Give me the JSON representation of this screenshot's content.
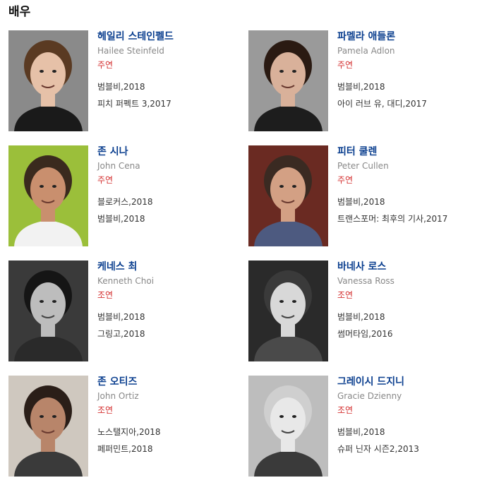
{
  "section": {
    "title": "배우"
  },
  "actors": [
    {
      "name": "헤일리 스테인펠드",
      "en_name": "Hailee Steinfeld",
      "role": "주연",
      "works": [
        "범블비,2018",
        "피치 퍼펙트 3,2017"
      ],
      "photo": {
        "bg": "#8a8a8a",
        "skin": "#e6c1a8",
        "hair": "#5a3a22",
        "shirt": "#1a1a1a",
        "gray": false
      }
    },
    {
      "name": "파멜라 애들론",
      "en_name": "Pamela Adlon",
      "role": "주연",
      "works": [
        "범블비,2018",
        "아이 러브 유, 대디,2017"
      ],
      "photo": {
        "bg": "#9a9a9a",
        "skin": "#d9b19a",
        "hair": "#2a1a12",
        "shirt": "#1d1d1d",
        "gray": false
      }
    },
    {
      "name": "존 시나",
      "en_name": "John Cena",
      "role": "주연",
      "works": [
        "블로커스,2018",
        "범블비,2018"
      ],
      "photo": {
        "bg": "#9bbf3a",
        "skin": "#c98f6e",
        "hair": "#3a2a1e",
        "shirt": "#f2f2f2",
        "gray": false
      }
    },
    {
      "name": "피터 쿨렌",
      "en_name": "Peter Cullen",
      "role": "주연",
      "works": [
        "범블비,2018",
        "트랜스포머: 최후의 기사,2017"
      ],
      "photo": {
        "bg": "#6a2a22",
        "skin": "#d3a084",
        "hair": "#3a2a22",
        "shirt": "#4d5a80",
        "gray": false
      }
    },
    {
      "name": "케네스 최",
      "en_name": "Kenneth Choi",
      "role": "조연",
      "works": [
        "범블비,2018",
        "그링고,2018"
      ],
      "photo": {
        "bg": "#3a3a3a",
        "skin": "#bdbdbd",
        "hair": "#151515",
        "shirt": "#2a2a2a",
        "gray": true
      }
    },
    {
      "name": "바네사 로스",
      "en_name": "Vanessa Ross",
      "role": "조연",
      "works": [
        "범블비,2018",
        "썸머타임,2016"
      ],
      "photo": {
        "bg": "#2a2a2a",
        "skin": "#d8d8d8",
        "hair": "#3a3a3a",
        "shirt": "#4a4a4a",
        "gray": true
      }
    },
    {
      "name": "존 오티즈",
      "en_name": "John Ortiz",
      "role": "조연",
      "works": [
        "노스탤지아,2018",
        "페퍼민트,2018"
      ],
      "photo": {
        "bg": "#cfc8bf",
        "skin": "#b8856a",
        "hair": "#2a1e18",
        "shirt": "#3a3a3a",
        "gray": false
      }
    },
    {
      "name": "그레이시 드지니",
      "en_name": "Gracie Dzienny",
      "role": "조연",
      "works": [
        "범블비,2018",
        "슈퍼 닌자 시즌2,2013"
      ],
      "photo": {
        "bg": "#bdbdbd",
        "skin": "#e8e8e8",
        "hair": "#cfcfcf",
        "shirt": "#3a3a3a",
        "gray": true
      }
    }
  ]
}
